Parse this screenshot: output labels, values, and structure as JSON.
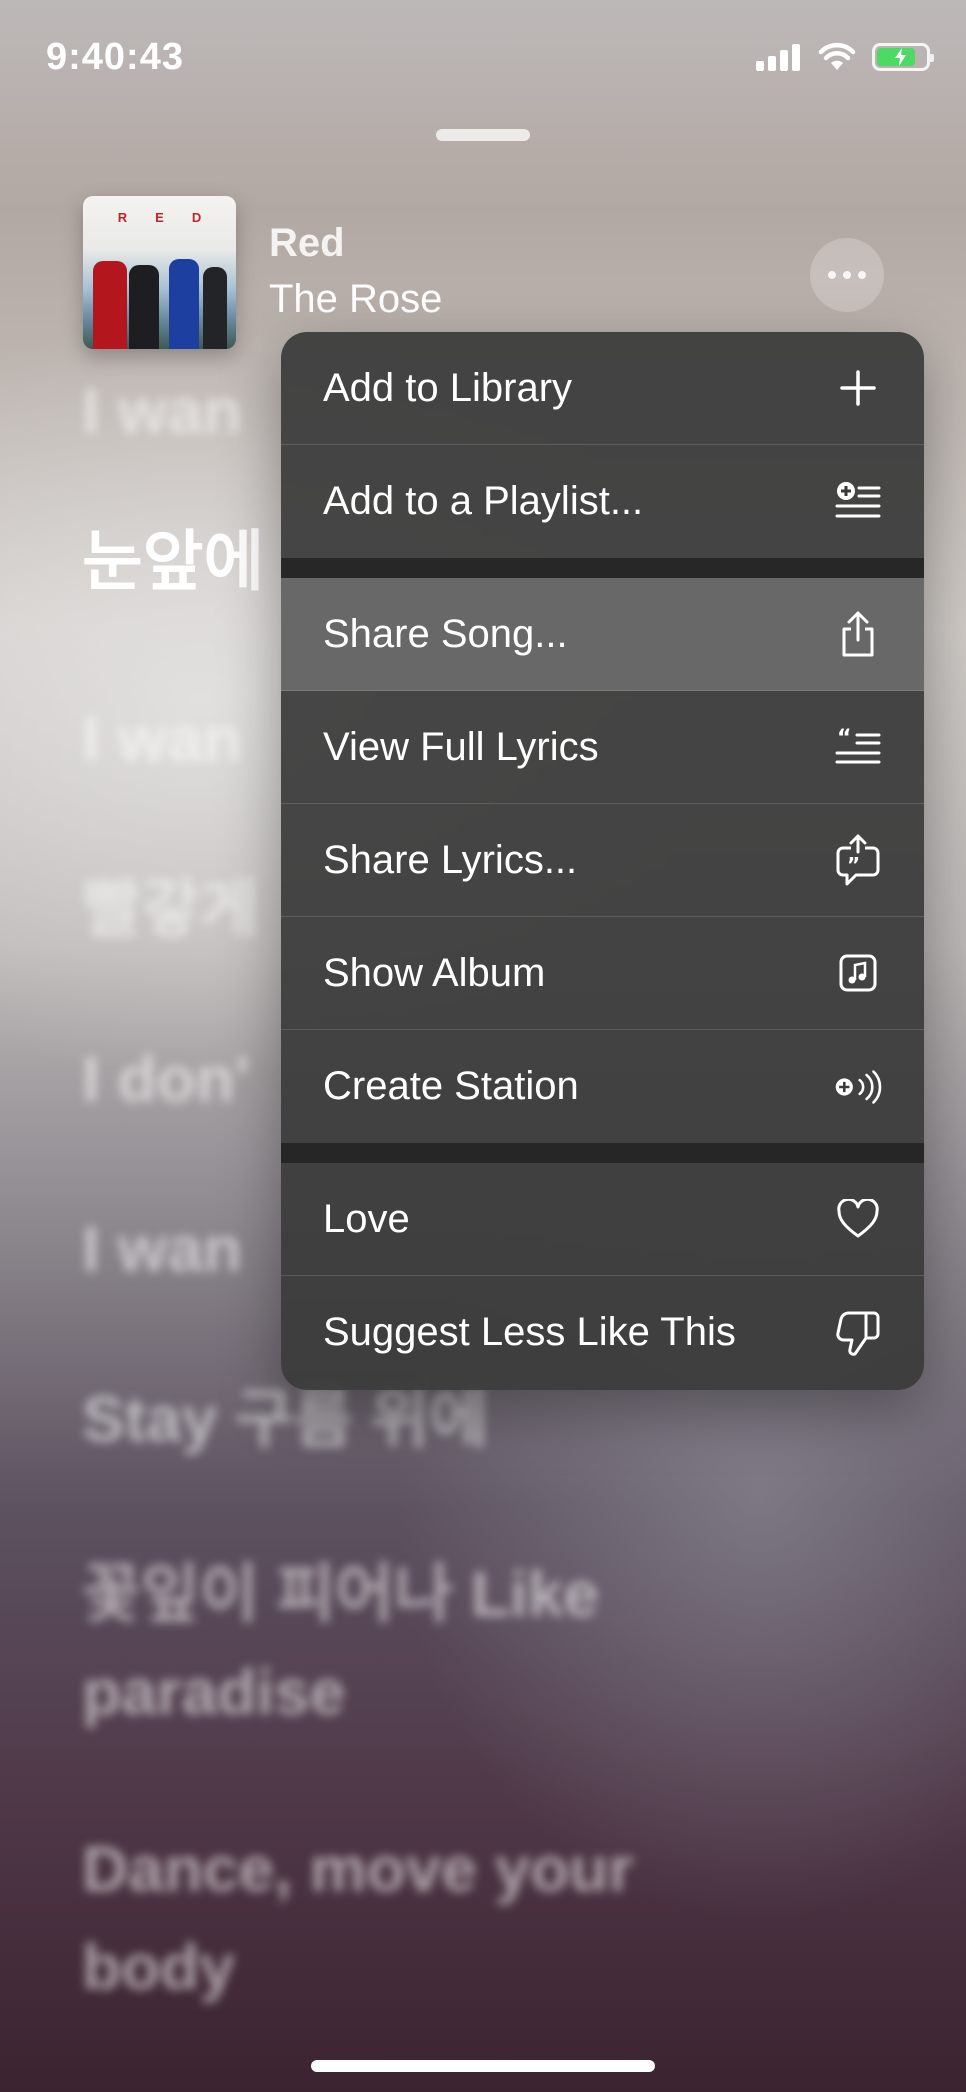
{
  "status_bar": {
    "time": "9:40:43"
  },
  "now_playing": {
    "song_title": "Red",
    "artist": "The Rose",
    "album_art_text": "RED"
  },
  "lyrics": [
    {
      "text": "I wan",
      "active": false
    },
    {
      "text": "눈앞에",
      "active": true
    },
    {
      "text": "I wan",
      "active": false
    },
    {
      "text": "빨갛게",
      "active": false
    },
    {
      "text": "I don'",
      "active": false
    },
    {
      "text": "I wan",
      "active": false
    },
    {
      "text": "Stay 구름 위에",
      "active": false
    },
    {
      "text": "꽃잎이 피어나 Like",
      "active": false
    },
    {
      "text": "paradise",
      "active": false
    },
    {
      "text": "Dance, move your",
      "active": false
    },
    {
      "text": "body",
      "active": false
    }
  ],
  "context_menu": {
    "items": [
      {
        "label": "Add to Library",
        "icon": "plus-icon"
      },
      {
        "label": "Add to a Playlist...",
        "icon": "add-to-playlist-icon"
      },
      {
        "label": "Share Song...",
        "icon": "share-icon"
      },
      {
        "label": "View Full Lyrics",
        "icon": "lyrics-icon"
      },
      {
        "label": "Share Lyrics...",
        "icon": "share-lyrics-icon"
      },
      {
        "label": "Show Album",
        "icon": "music-note-album-icon"
      },
      {
        "label": "Create Station",
        "icon": "station-icon"
      },
      {
        "label": "Love",
        "icon": "heart-icon"
      },
      {
        "label": "Suggest Less Like This",
        "icon": "thumbs-down-icon"
      }
    ]
  },
  "colors": {
    "menu_background": "#3a3a3a",
    "battery_fill": "#4cd964",
    "album_title_red": "#c0262b"
  }
}
